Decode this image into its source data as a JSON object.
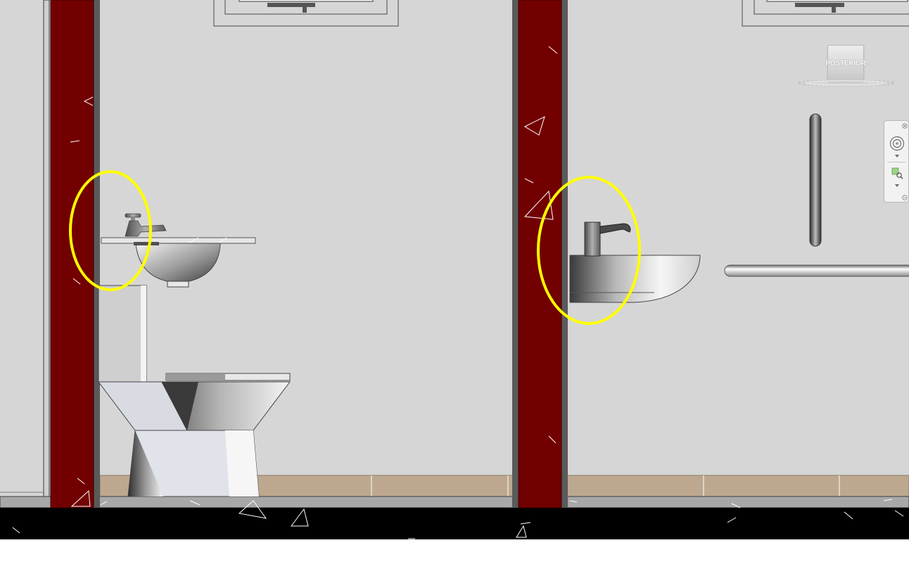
{
  "viewcube": {
    "face_label": "POSTERIOR"
  },
  "navigation_bar": {
    "items": [
      {
        "name": "close-icon"
      },
      {
        "name": "steering-wheel-icon"
      },
      {
        "name": "chevron-down-icon"
      },
      {
        "name": "zoom-region-icon"
      },
      {
        "name": "chevron-down-icon"
      },
      {
        "name": "options-icon"
      }
    ]
  },
  "scene": {
    "objects": [
      "wall",
      "structural-column",
      "wash-basin",
      "toilet",
      "grab-bar",
      "skirting",
      "window"
    ],
    "annotations": {
      "highlight_color": "#ffff00",
      "highlighted": [
        "basin-tap-left",
        "basin-tap-right"
      ]
    },
    "colors": {
      "wall": "#d6d6d6",
      "column": "#720000",
      "skirting": "#bda88f",
      "floor_section": "#000000"
    }
  }
}
